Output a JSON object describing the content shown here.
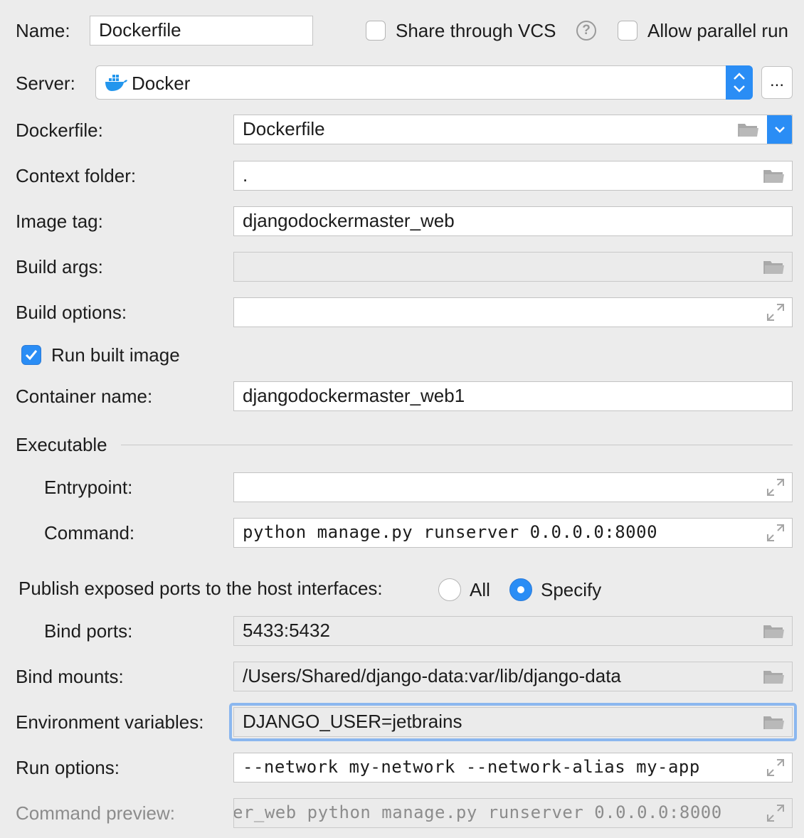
{
  "header": {
    "name_label": "Name:",
    "name_value": "Dockerfile",
    "share_vcs_label": "Share through VCS",
    "share_vcs_checked": false,
    "help_glyph": "?",
    "allow_parallel_label": "Allow parallel run",
    "allow_parallel_checked": false
  },
  "server": {
    "label": "Server:",
    "value": "Docker",
    "icon": "docker-whale-icon",
    "more_label": "..."
  },
  "dockerfile": {
    "label": "Dockerfile:",
    "value": "Dockerfile"
  },
  "context_folder": {
    "label": "Context folder:",
    "value": "."
  },
  "image_tag": {
    "label": "Image tag:",
    "value": "djangodockermaster_web"
  },
  "build_args": {
    "label": "Build args:",
    "value": ""
  },
  "build_options": {
    "label": "Build options:",
    "value": ""
  },
  "run_built_image": {
    "label": "Run built image",
    "checked": true
  },
  "container_name": {
    "label": "Container name:",
    "value": "djangodockermaster_web1"
  },
  "executable": {
    "section_label": "Executable",
    "entrypoint_label": "Entrypoint:",
    "entrypoint_value": "",
    "command_label": "Command:",
    "command_value": "python manage.py runserver 0.0.0.0:8000"
  },
  "publish": {
    "label": "Publish exposed ports to the host interfaces:",
    "options": [
      "All",
      "Specify"
    ],
    "selected": "Specify"
  },
  "bind_ports": {
    "label": "Bind ports:",
    "value": "5433:5432"
  },
  "bind_mounts": {
    "label": "Bind mounts:",
    "value": "/Users/Shared/django-data:var/lib/django-data"
  },
  "env_vars": {
    "label": "Environment variables:",
    "value": "DJANGO_USER=jetbrains"
  },
  "run_options": {
    "label": "Run options:",
    "value": "--network my-network --network-alias my-app"
  },
  "command_preview": {
    "label": "Command preview:",
    "value": "er_web python manage.py runserver 0.0.0.0:8000"
  },
  "colors": {
    "accent": "#2a8df5",
    "background": "#ececec",
    "focus_ring": "#8bb7ef",
    "disabled_text": "#8c8c8c"
  }
}
